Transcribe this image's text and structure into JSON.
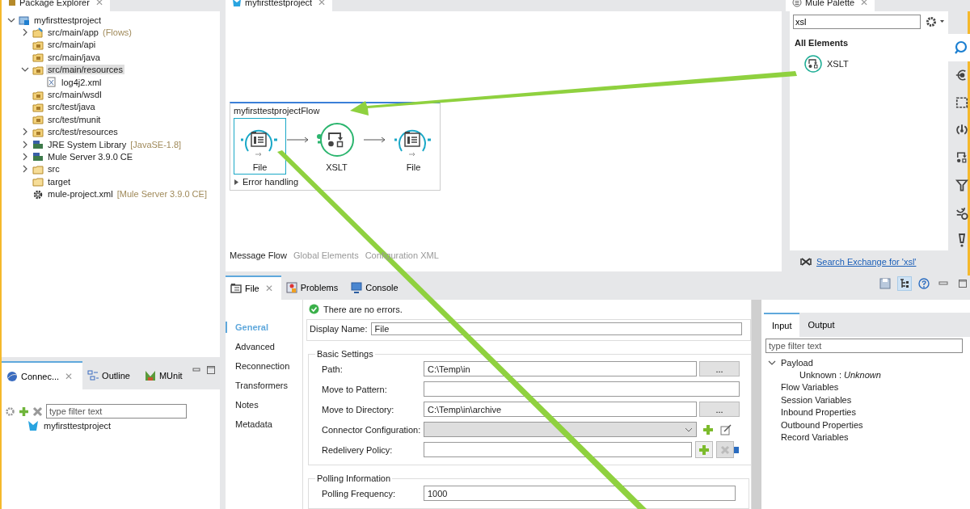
{
  "package_explorer": {
    "title": "Package Explorer",
    "close": "✕",
    "tree": [
      {
        "label": "myfirsttestproject",
        "kind": "project",
        "expanded": true,
        "selected": false,
        "children": [
          {
            "label": "src/main/app",
            "note": "(Flows)",
            "kind": "flows-folder",
            "expanded": false,
            "selected": false
          },
          {
            "label": "src/main/api",
            "kind": "package-folder",
            "selected": false
          },
          {
            "label": "src/main/java",
            "kind": "package-folder",
            "selected": false
          },
          {
            "label": "src/main/resources",
            "kind": "package-folder",
            "expanded": true,
            "selected": true,
            "children": [
              {
                "label": "log4j2.xml",
                "kind": "xml-file",
                "selected": false
              }
            ]
          },
          {
            "label": "src/main/wsdl",
            "kind": "package-folder",
            "selected": false
          },
          {
            "label": "src/test/java",
            "kind": "package-folder",
            "selected": false
          },
          {
            "label": "src/test/munit",
            "kind": "package-folder",
            "selected": false
          },
          {
            "label": "src/test/resources",
            "kind": "package-folder",
            "expanded": false,
            "selected": false
          },
          {
            "label": "JRE System Library",
            "note": "[JavaSE-1.8]",
            "kind": "library",
            "expanded": false,
            "selected": false
          },
          {
            "label": "Mule Server 3.9.0 CE",
            "kind": "library",
            "expanded": false,
            "selected": false
          },
          {
            "label": "src",
            "kind": "folder",
            "expanded": false,
            "selected": false
          },
          {
            "label": "target",
            "kind": "folder",
            "selected": false
          },
          {
            "label": "mule-project.xml",
            "note": "[Mule Server 3.9.0 CE]",
            "kind": "gear",
            "selected": false
          }
        ]
      }
    ]
  },
  "connections": {
    "tabs": [
      {
        "label": "Connec...",
        "kind": "globe",
        "selected": true,
        "close": "✕"
      },
      {
        "label": "Outline",
        "kind": "outline",
        "selected": false
      },
      {
        "label": "MUnit",
        "kind": "munit",
        "selected": false
      }
    ],
    "filter": {
      "placeholder": "type filter text"
    },
    "items": [
      {
        "label": "myfirsttestproject"
      }
    ]
  },
  "editor": {
    "tab": {
      "label": "myfirsttestproject",
      "close": "✕"
    },
    "flow": {
      "title": "myfirsttestprojectFlow",
      "nodes": [
        {
          "label": "File",
          "kind": "file",
          "selected": true
        },
        {
          "label": "XSLT",
          "kind": "xslt",
          "selected": false
        },
        {
          "label": "File",
          "kind": "file",
          "selected": false
        }
      ],
      "error_handling": {
        "label": "Error handling",
        "expanded": false
      }
    },
    "view_tabs": [
      {
        "label": "Message Flow",
        "selected": true
      },
      {
        "label": "Global Elements",
        "selected": false
      },
      {
        "label": "Configuration XML",
        "selected": false
      }
    ]
  },
  "palette": {
    "title": "Mule Palette",
    "close": "✕",
    "search": {
      "value": "xsl"
    },
    "section": "All Elements",
    "items": [
      {
        "label": "XSLT",
        "kind": "xslt"
      }
    ],
    "exchange_link": "Search Exchange for 'xsl'",
    "side_icons": [
      {
        "kind": "search",
        "selected": true
      },
      {
        "kind": "endpoint",
        "selected": false
      },
      {
        "kind": "scope",
        "selected": false
      },
      {
        "kind": "component",
        "selected": false
      },
      {
        "kind": "transformer",
        "selected": false
      },
      {
        "kind": "filter",
        "selected": false
      },
      {
        "kind": "router",
        "selected": false
      },
      {
        "kind": "exception",
        "selected": false
      }
    ]
  },
  "properties": {
    "tabs": [
      {
        "label": "File",
        "kind": "file",
        "selected": true,
        "close": "✕"
      },
      {
        "label": "Problems",
        "kind": "problems",
        "selected": false
      },
      {
        "label": "Console",
        "kind": "console",
        "selected": false
      }
    ],
    "toolbar": [
      {
        "kind": "save",
        "pressed": false
      },
      {
        "kind": "tree",
        "pressed": true
      },
      {
        "kind": "help",
        "pressed": false
      },
      {
        "kind": "minimize",
        "pressed": false
      },
      {
        "kind": "maximize",
        "pressed": false
      }
    ],
    "status": "There are no errors.",
    "nav": [
      {
        "label": "General",
        "selected": true
      },
      {
        "label": "Advanced",
        "selected": false
      },
      {
        "label": "Reconnection",
        "selected": false
      },
      {
        "label": "Transformers",
        "selected": false
      },
      {
        "label": "Notes",
        "selected": false
      },
      {
        "label": "Metadata",
        "selected": false
      }
    ],
    "display_name": {
      "label": "Display Name:",
      "value": "File"
    },
    "sections": [
      {
        "title": "Basic Settings",
        "fields": [
          {
            "label": "Path:",
            "kind": "browse",
            "value": "C:\\Temp\\in",
            "button": "..."
          },
          {
            "label": "Move to Pattern:",
            "kind": "text"
          },
          {
            "label": "Move to Directory:",
            "kind": "browse",
            "value": "C:\\Temp\\in\\archive",
            "button": "..."
          },
          {
            "label": "Connector Configuration:",
            "kind": "select",
            "disabled": true
          },
          {
            "label": "Redelivery Policy:",
            "kind": "policy"
          }
        ]
      },
      {
        "title": "Polling Information",
        "fields": [
          {
            "label": "Polling Frequency:",
            "kind": "text",
            "value": "1000"
          }
        ]
      }
    ]
  },
  "metadata": {
    "tabs": [
      {
        "label": "Input",
        "selected": true
      },
      {
        "label": "Output",
        "selected": false
      }
    ],
    "filter": {
      "placeholder": "type filter text"
    },
    "tree": [
      {
        "label": "Payload",
        "expanded": true,
        "children": [
          {
            "label": "Unknown : *Unknown*"
          }
        ]
      },
      {
        "label": "Flow Variables"
      },
      {
        "label": "Session Variables"
      },
      {
        "label": "Inbound Properties"
      },
      {
        "label": "Outbound Properties"
      },
      {
        "label": "Record Variables"
      }
    ]
  }
}
